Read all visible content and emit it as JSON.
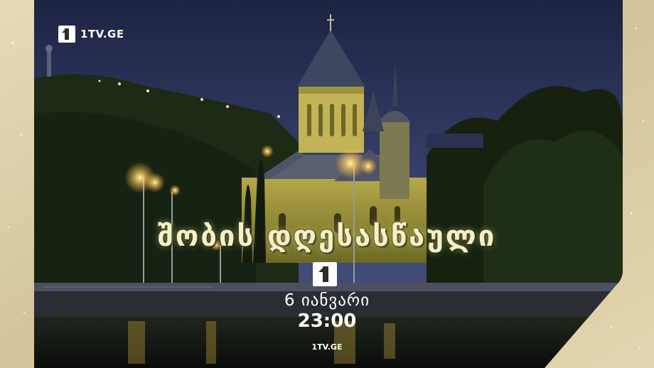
{
  "brand": {
    "top_logo_text": "1TV.GE",
    "bottom_url": "1TV.GE",
    "logo_icon": "first-channel-logo-icon"
  },
  "promo": {
    "title": "შობის დღესასწაული",
    "date": "6 იანვარი",
    "time": "23:00"
  },
  "colors": {
    "frame_gold": "#d8cba6",
    "sky": "#2a3150",
    "title_glow": "#f4f1c8"
  }
}
